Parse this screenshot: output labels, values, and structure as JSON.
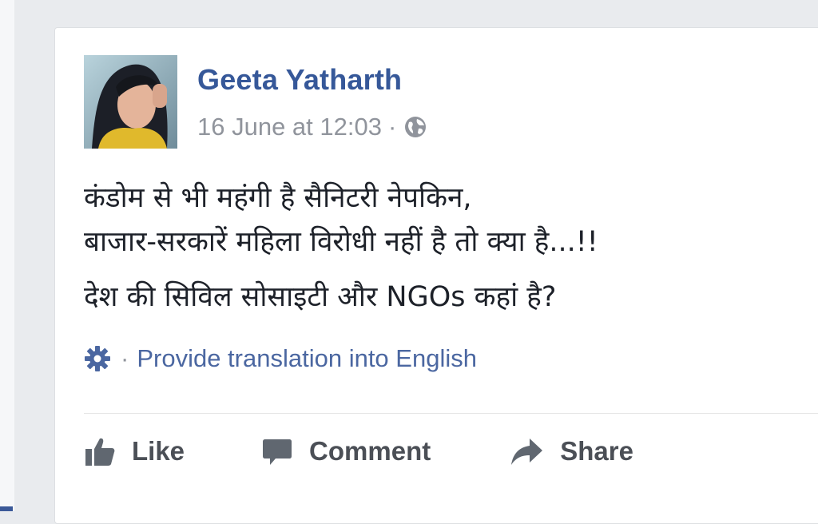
{
  "post": {
    "author": "Geeta Yatharth",
    "timestamp": "16 June at 12:03",
    "separator": "·",
    "privacy_icon": "globe-icon",
    "text_lines": [
      "कंडोम से भी महंगी है सैनिटरी नेपकिन,",
      "बाजार-सरकारें महिला विरोधी नहीं है तो क्या है...!!",
      "देश की सिविल सोसाइटी और NGOs कहां है?"
    ],
    "translate_separator": "·",
    "translate_link": "Provide translation into English"
  },
  "actions": {
    "like": "Like",
    "comment": "Comment",
    "share": "Share"
  },
  "colors": {
    "page_bg": "#e9ebee",
    "author": "#365899",
    "link": "#4b67a1",
    "meta": "#90949c",
    "action": "#606770"
  }
}
